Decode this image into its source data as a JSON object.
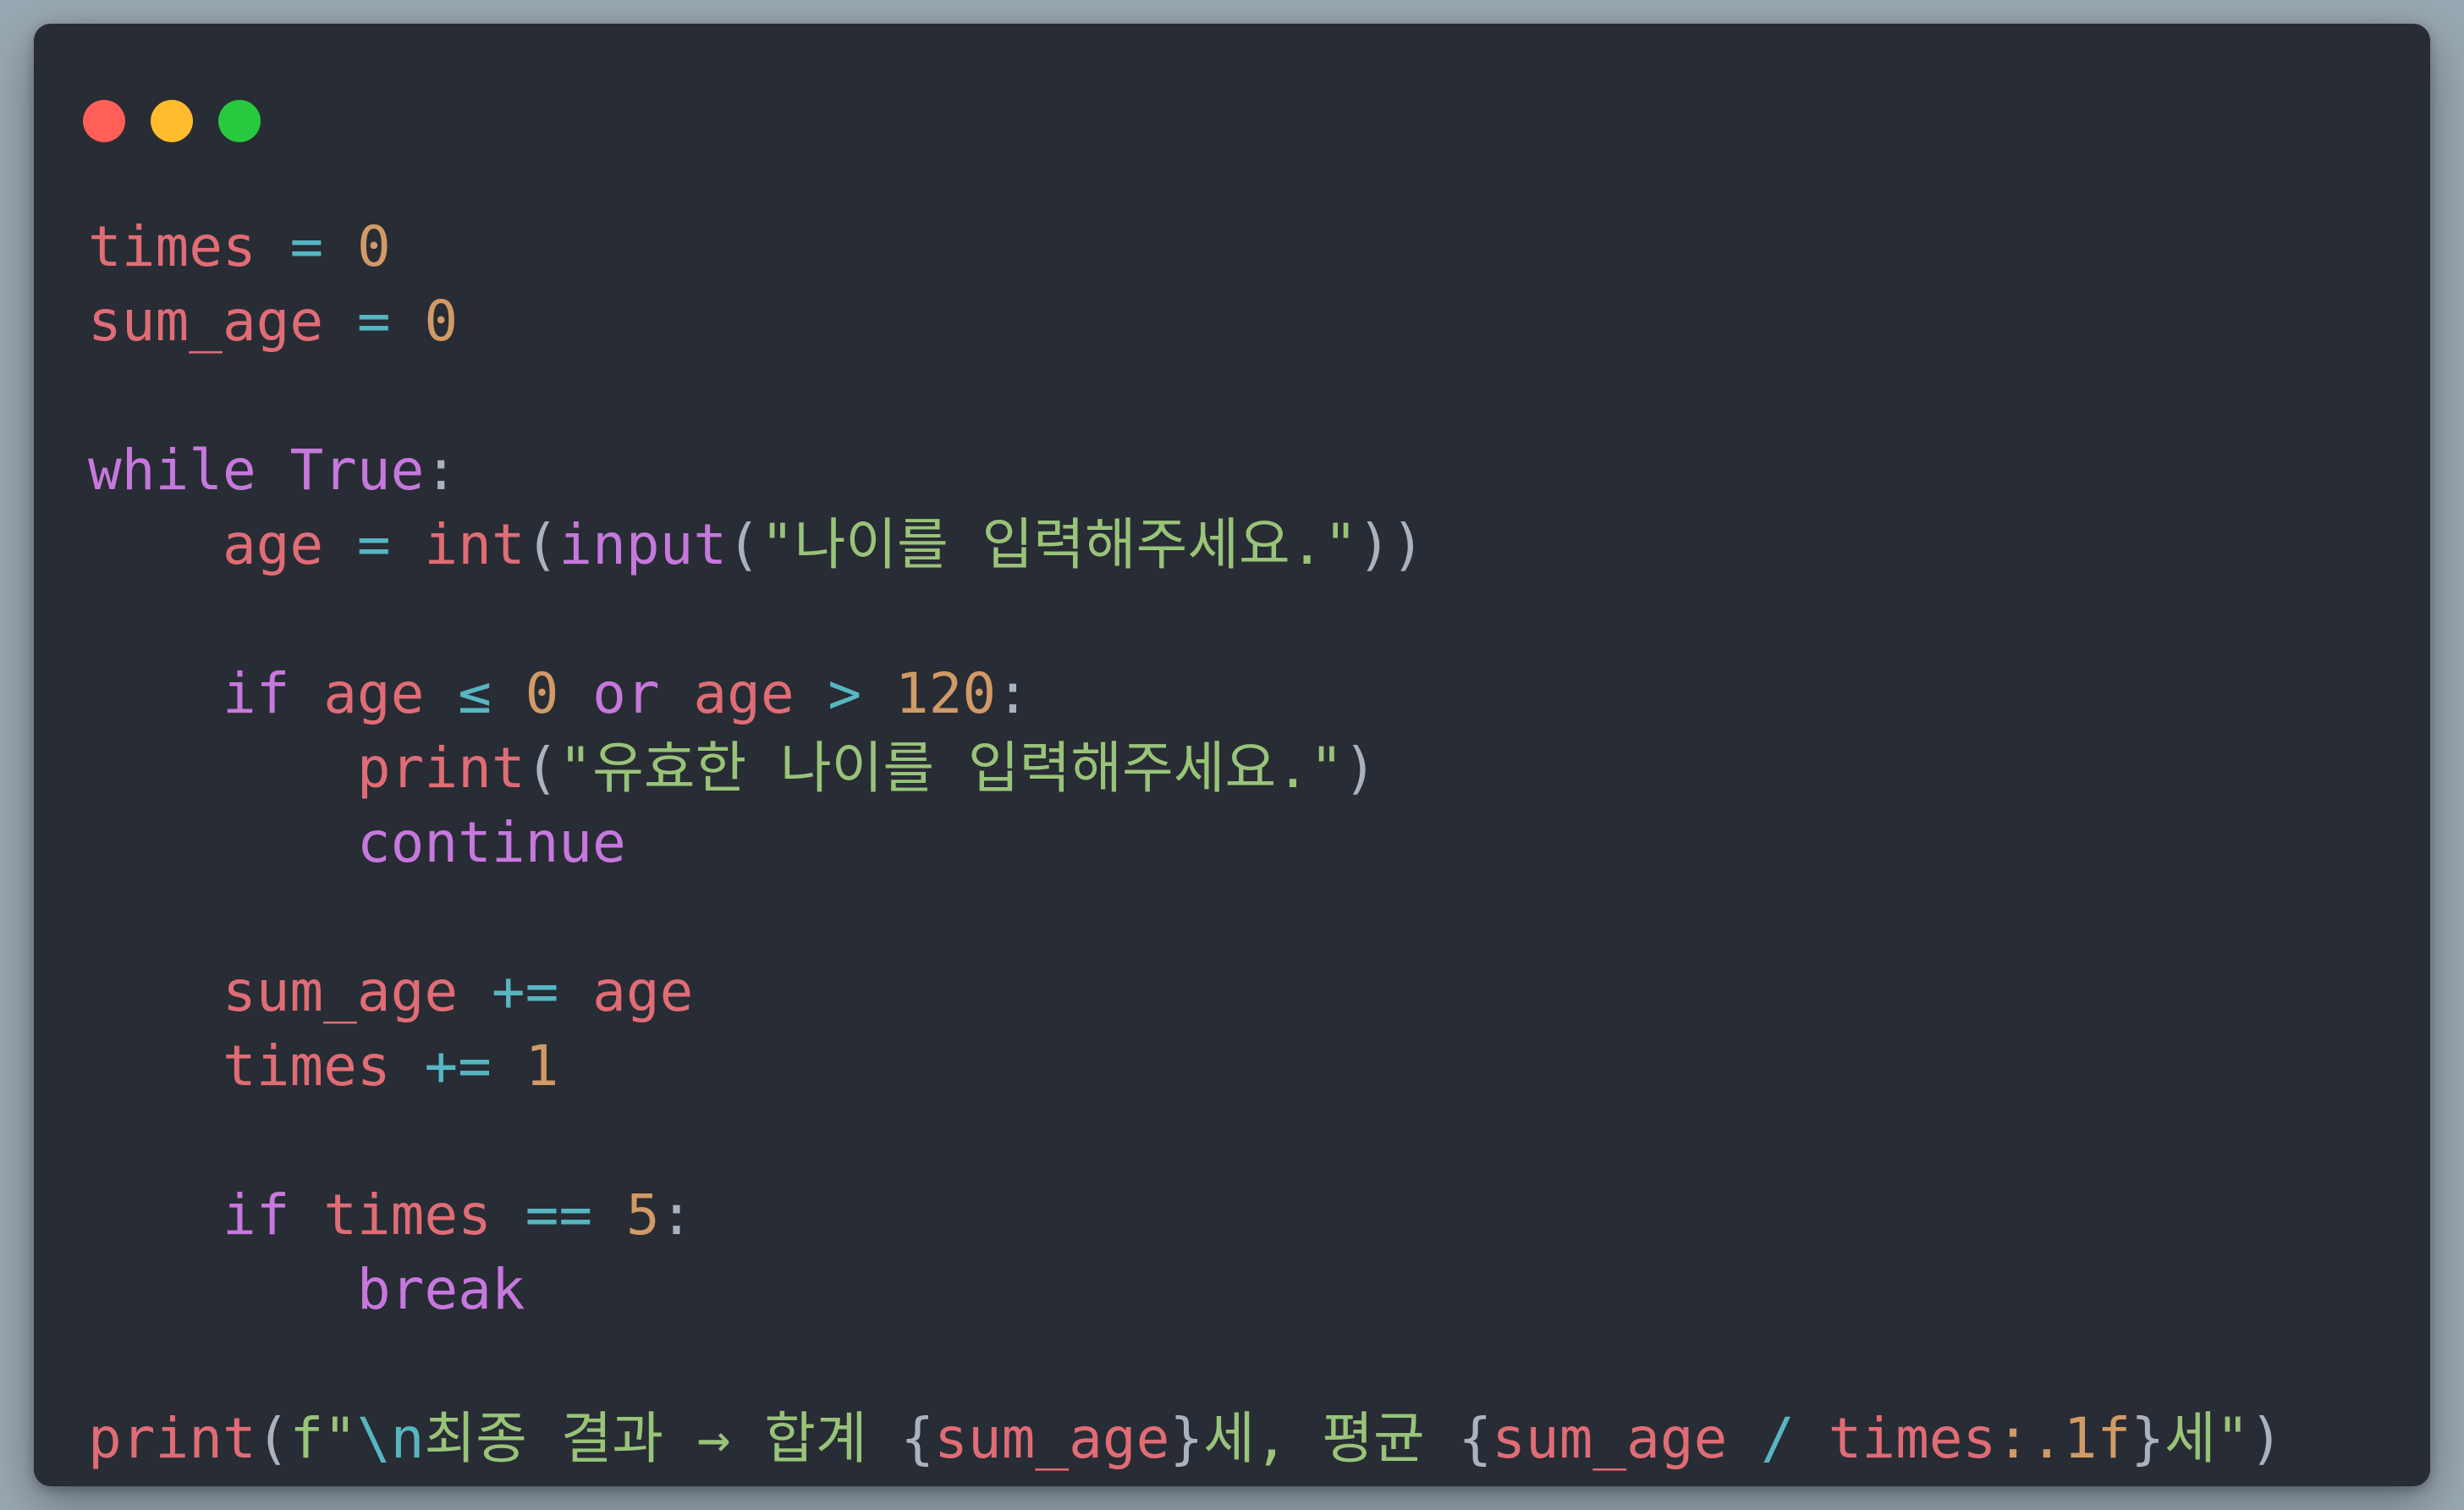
{
  "window": {
    "traffic_lights": [
      {
        "name": "close",
        "color": "#ff5f56"
      },
      {
        "name": "minimize",
        "color": "#ffbd2e"
      },
      {
        "name": "zoom",
        "color": "#27c93f"
      }
    ]
  },
  "code": {
    "line1": {
      "var": "times",
      "op": "=",
      "num": "0"
    },
    "line2": {
      "var": "sum_age",
      "op": "=",
      "num": "0"
    },
    "line4": {
      "kw": "while",
      "const": "True",
      "punc": ":"
    },
    "line5": {
      "var": "age",
      "op": "=",
      "fn1": "int",
      "fn2": "input",
      "str": "\"나이를 입력해주세요.\""
    },
    "line7": {
      "kw": "if",
      "var1": "age",
      "op1": "≤",
      "num1": "0",
      "kw2": "or",
      "var2": "age",
      "op2": ">",
      "num2": "120",
      "punc": ":"
    },
    "line8": {
      "fn": "print",
      "str": "\"유효한 나이를 입력해주세요.\""
    },
    "line9": {
      "kw": "continue"
    },
    "line11": {
      "var1": "sum_age",
      "op": "+=",
      "var2": "age"
    },
    "line12": {
      "var": "times",
      "op": "+=",
      "num": "1"
    },
    "line14": {
      "kw": "if",
      "var": "times",
      "op": "==",
      "num": "5",
      "punc": ":"
    },
    "line15": {
      "kw": "break"
    },
    "line17": {
      "fn": "print",
      "prefix": "f\"",
      "esc": "\\n",
      "text1": "최종 결과 → 합계 ",
      "expr1": "sum_age",
      "text2": "세, 평균 ",
      "expr2a": "sum_age",
      "op": "/",
      "expr2b": "times",
      "fmt": ":.1f",
      "text3": "세\""
    }
  }
}
